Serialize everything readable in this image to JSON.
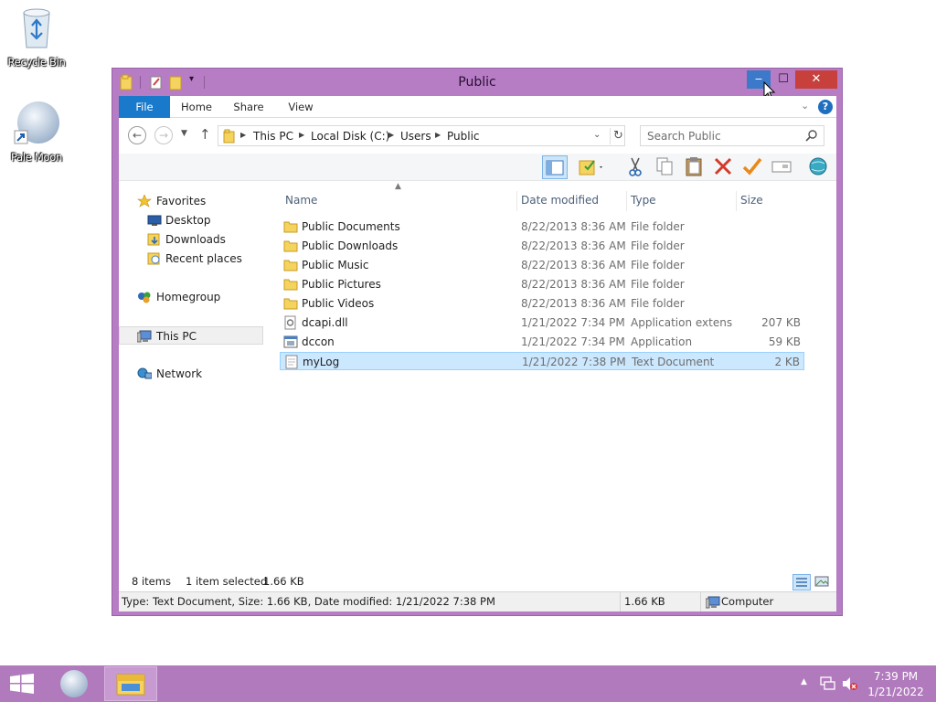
{
  "desktop": {
    "icons": [
      {
        "label": "Recycle Bin"
      },
      {
        "label": "Pale Moon"
      }
    ]
  },
  "window": {
    "title": "Public",
    "ribbon_tabs": [
      "File",
      "Home",
      "Share",
      "View"
    ],
    "address": {
      "crumbs": [
        "This PC",
        "Local Disk (C:)",
        "Users",
        "Public"
      ]
    },
    "search": {
      "placeholder": "Search Public"
    },
    "nav": {
      "favorites": "Favorites",
      "desktop": "Desktop",
      "downloads": "Downloads",
      "recent": "Recent places",
      "homegroup": "Homegroup",
      "thispc": "This PC",
      "network": "Network"
    },
    "columns": {
      "name": "Name",
      "date": "Date modified",
      "type": "Type",
      "size": "Size"
    },
    "files": [
      {
        "name": "Public Documents",
        "date": "8/22/2013 8:36 AM",
        "type": "File folder",
        "size": "",
        "kind": "folder"
      },
      {
        "name": "Public Downloads",
        "date": "8/22/2013 8:36 AM",
        "type": "File folder",
        "size": "",
        "kind": "folder"
      },
      {
        "name": "Public Music",
        "date": "8/22/2013 8:36 AM",
        "type": "File folder",
        "size": "",
        "kind": "folder"
      },
      {
        "name": "Public Pictures",
        "date": "8/22/2013 8:36 AM",
        "type": "File folder",
        "size": "",
        "kind": "folder"
      },
      {
        "name": "Public Videos",
        "date": "8/22/2013 8:36 AM",
        "type": "File folder",
        "size": "",
        "kind": "folder"
      },
      {
        "name": "dcapi.dll",
        "date": "1/21/2022 7:34 PM",
        "type": "Application extens...",
        "size": "207 KB",
        "kind": "dll"
      },
      {
        "name": "dccon",
        "date": "1/21/2022 7:34 PM",
        "type": "Application",
        "size": "59 KB",
        "kind": "app"
      },
      {
        "name": "myLog",
        "date": "1/21/2022 7:38 PM",
        "type": "Text Document",
        "size": "2 KB",
        "kind": "text",
        "selected": true
      }
    ],
    "status": {
      "count": "8 items",
      "selected": "1 item selected",
      "size": "1.66 KB"
    },
    "details": {
      "text": "Type: Text Document, Size: 1.66 KB, Date modified: 1/21/2022 7:38 PM",
      "size": "1.66 KB",
      "location": "Computer"
    }
  },
  "taskbar": {
    "time": "7:39 PM",
    "date": "1/21/2022"
  },
  "colors": {
    "window_frame": "#b67cc4",
    "taskbar": "#b17abd",
    "file_tab": "#1979ca",
    "close_button": "#c7403b",
    "selection": "#cce8ff"
  }
}
